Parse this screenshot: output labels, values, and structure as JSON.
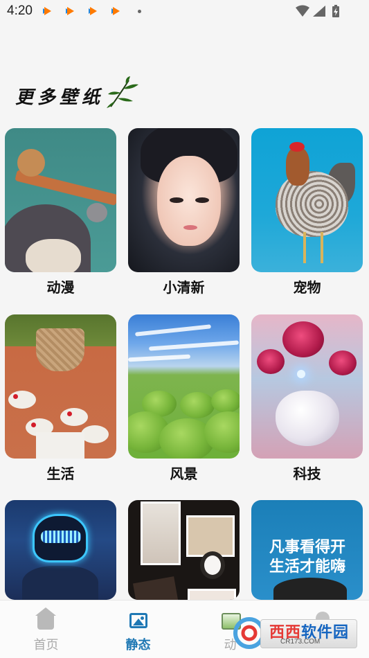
{
  "status_bar": {
    "time": "4:20",
    "notifications": [
      "app-notification-icon",
      "app-notification-icon",
      "app-notification-icon",
      "app-notification-icon"
    ]
  },
  "header": {
    "title": "更多壁纸"
  },
  "categories": [
    {
      "label": "动漫"
    },
    {
      "label": "小清新"
    },
    {
      "label": "宠物"
    },
    {
      "label": "生活"
    },
    {
      "label": "风景"
    },
    {
      "label": "科技"
    },
    {
      "label": "",
      "overlay_text": ""
    },
    {
      "label": ""
    },
    {
      "label": "",
      "overlay_text": "凡事看得开\n生活才能嗨"
    }
  ],
  "bottom_nav": {
    "items": [
      {
        "label": "首页",
        "icon": "home-icon",
        "active": false
      },
      {
        "label": "静态",
        "icon": "image-icon",
        "active": true
      },
      {
        "label": "动",
        "icon": "dynamic-image-icon",
        "active": false
      },
      {
        "label": "",
        "icon": "user-icon",
        "active": false
      }
    ]
  },
  "watermark": {
    "title_red": "西西",
    "title_blue": "软件园",
    "sub": "CR173.COM"
  },
  "colors": {
    "accent": "#1f78b4",
    "inactive": "#aaaaaa",
    "background": "#f5f5f5"
  }
}
